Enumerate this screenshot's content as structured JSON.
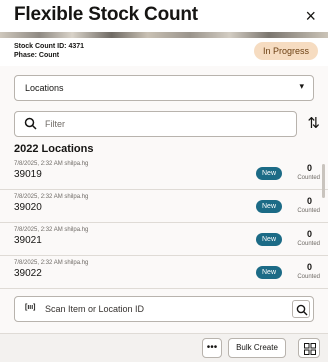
{
  "dialog": {
    "title": "Flexible Stock Count",
    "close_icon": "×"
  },
  "info": {
    "stock_count_id": "Stock Count ID: 4371",
    "phase": "Phase: Count",
    "status": "In Progress"
  },
  "locations_select": {
    "label": "Locations",
    "caret": "▾"
  },
  "filter": {
    "placeholder": "Filter",
    "sort_icon": "⇅"
  },
  "list": {
    "heading": "2022 Locations",
    "items": [
      {
        "meta": "7/8/2025, 2:32 AM shilpa.hg",
        "location": "39019",
        "status": "New",
        "count": "0",
        "count_label": "Counted"
      },
      {
        "meta": "7/8/2025, 2:32 AM shilpa.hg",
        "location": "39020",
        "status": "New",
        "count": "0",
        "count_label": "Counted"
      },
      {
        "meta": "7/8/2025, 2:32 AM shilpa.hg",
        "location": "39021",
        "status": "New",
        "count": "0",
        "count_label": "Counted"
      },
      {
        "meta": "7/8/2025, 2:32 AM shilpa.hg",
        "location": "39022",
        "status": "New",
        "count": "0",
        "count_label": "Counted"
      }
    ]
  },
  "scan": {
    "placeholder": "Scan Item or Location ID",
    "barcode_icon": "[ııı]"
  },
  "footer": {
    "more_label": "•••",
    "bulk_create_label": "Bulk Create"
  },
  "colors": {
    "status_badge_bg": "#f6dcc1",
    "new_badge_bg": "#1c6b86"
  }
}
